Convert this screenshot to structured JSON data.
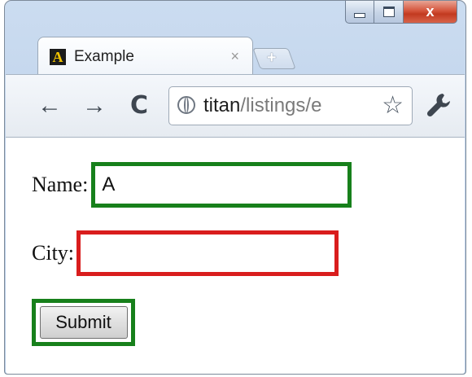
{
  "window": {
    "controls": {
      "minimize_icon": "minimize-icon",
      "maximize_icon": "maximize-icon",
      "close_glyph": "x"
    }
  },
  "tab": {
    "logo_letter": "A",
    "title": "Example",
    "close_glyph": "×",
    "new_tab_glyph": "+"
  },
  "toolbar": {
    "back_glyph": "←",
    "forward_glyph": "→",
    "reload_glyph": "C",
    "url_host": "titan",
    "url_path": "/listings/e",
    "star_glyph": "☆",
    "wrench_glyph": "🔧"
  },
  "form": {
    "name_label": "Name:",
    "name_value": "A",
    "city_label": "City:",
    "city_value": "",
    "submit_label": "Submit"
  },
  "colors": {
    "valid_border": "#17801b",
    "invalid_border": "#d91d1d"
  }
}
